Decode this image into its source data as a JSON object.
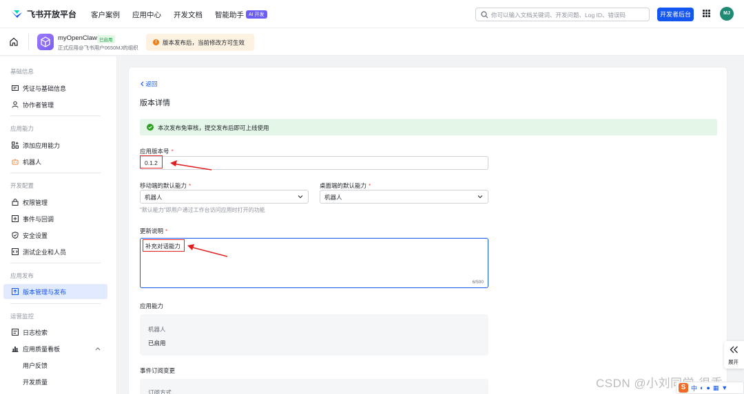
{
  "topbar": {
    "brand": "飞书开放平台",
    "nav": [
      "客户案例",
      "应用中心",
      "开发文档",
      "智能助手"
    ],
    "ai_badge": "AI 开发",
    "search_placeholder": "你可以输入文档关键词、开发问题、Log ID、错误码",
    "dev_console": "开发者后台",
    "avatar_initials": "MJ"
  },
  "appbar": {
    "app_name": "myOpenClaw",
    "status": "已启用",
    "org": "正式应用@飞书用户0650MJ的组织",
    "notice": "版本发布后，当前修改方可生效"
  },
  "sidebar": {
    "groups": [
      {
        "title": "基础信息",
        "items": [
          "凭证与基础信息",
          "协作者管理"
        ]
      },
      {
        "title": "应用能力",
        "items": [
          "添加应用能力",
          "机器人"
        ]
      },
      {
        "title": "开发配置",
        "items": [
          "权限管理",
          "事件与回调",
          "安全设置",
          "测试企业和人员"
        ]
      },
      {
        "title": "应用发布",
        "items": [
          "版本管理与发布"
        ]
      },
      {
        "title": "运营监控",
        "items": [
          "日志检索",
          "应用质量看板"
        ],
        "subitems": [
          "用户反馈",
          "开发质量"
        ]
      }
    ]
  },
  "main": {
    "back": "返回",
    "title": "版本详情",
    "success_notice": "本次发布免审核，提交发布后即可上线使用",
    "version_label": "应用版本号",
    "version_value": "0.1.2",
    "mobile_label": "移动端的默认能力",
    "mobile_value": "机器人",
    "desktop_label": "桌面端的默认能力",
    "desktop_value": "机器人",
    "default_hint": "\"默认能力\"即用户通过工作台访问应用时打开的功能",
    "notes_label": "更新说明",
    "notes_value": "补充对话能力",
    "notes_counter": "6/500",
    "capability_label": "应用能力",
    "capability_name": "机器人",
    "capability_status": "已启用",
    "event_label": "事件订阅变更",
    "event_sub": "订阅方式"
  },
  "float": {
    "expand": "展开"
  },
  "watermark": "CSDN @小刘同学-很乖",
  "ime": {
    "logo": "S",
    "lang": "中"
  },
  "colors": {
    "primary": "#1456f0",
    "success": "#2ea121",
    "warning": "#f57e10",
    "annotation": "#e02020"
  }
}
